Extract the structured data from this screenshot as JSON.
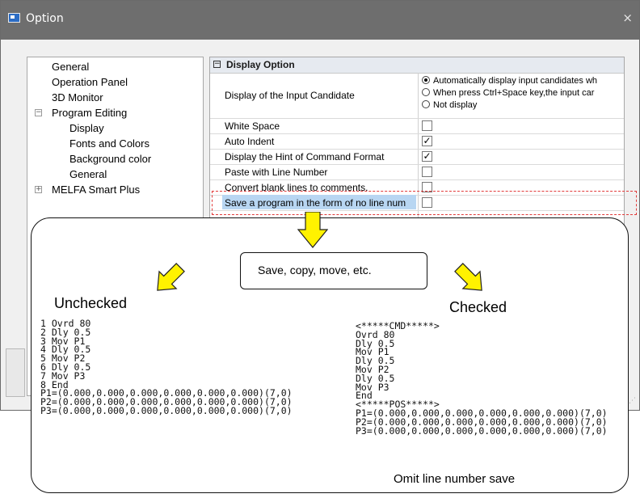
{
  "window": {
    "title": "Option",
    "close_glyph": "×"
  },
  "tree": [
    {
      "label": "General",
      "level": 0
    },
    {
      "label": "Operation Panel",
      "level": 0
    },
    {
      "label": "3D Monitor",
      "level": 0
    },
    {
      "label": "Program Editing",
      "level": 0,
      "expander": "−"
    },
    {
      "label": "Display",
      "level": 1
    },
    {
      "label": "Fonts and Colors",
      "level": 1
    },
    {
      "label": "Background color",
      "level": 1
    },
    {
      "label": "General",
      "level": 1
    },
    {
      "label": "MELFA Smart Plus",
      "level": 0,
      "expander": "+"
    }
  ],
  "grid": {
    "header_expander": "−",
    "header": "Display Option",
    "input_candidate": {
      "label": "Display of the Input Candidate",
      "options": [
        "Automatically display input candidates wh",
        "When press Ctrl+Space key,the input car",
        "Not display"
      ],
      "selected": 0
    },
    "rows": [
      {
        "label": "White Space",
        "checked": false
      },
      {
        "label": "Auto Indent",
        "checked": true
      },
      {
        "label": "Display the Hint of Command Format",
        "checked": true
      },
      {
        "label": "Paste with Line Number",
        "checked": false
      },
      {
        "label": "Convert blank lines to comments.",
        "checked": false
      },
      {
        "label": "Save a program in the form of no line num",
        "checked": false,
        "selected": true
      }
    ],
    "check_glyph": "✓"
  },
  "callout": {
    "action": "Save, copy, move, etc.",
    "unchecked_label": "Unchecked",
    "checked_label": "Checked",
    "footer": "Omit line number save",
    "unchecked_code": [
      "1 Ovrd 80",
      "2 Dly 0.5",
      "3 Mov P1",
      "4 Dly 0.5",
      "5 Mov P2",
      "6 Dly 0.5",
      "7 Mov P3",
      "8 End",
      "P1=(0.000,0.000,0.000,0.000,0.000,0.000)(7,0)",
      "P2=(0.000,0.000,0.000,0.000,0.000,0.000)(7,0)",
      "P3=(0.000,0.000,0.000,0.000,0.000,0.000)(7,0)"
    ],
    "checked_code": [
      "<*****CMD*****>",
      "Ovrd 80",
      "Dly 0.5",
      "Mov P1",
      "Dly 0.5",
      "Mov P2",
      "Dly 0.5",
      "Mov P3",
      "End",
      "<*****POS*****>",
      "P1=(0.000,0.000,0.000,0.000,0.000,0.000)(7,0)",
      "P2=(0.000,0.000,0.000,0.000,0.000,0.000)(7,0)",
      "P3=(0.000,0.000,0.000,0.000,0.000,0.000)(7,0)"
    ]
  },
  "colors": {
    "arrow_fill": "#fff200",
    "highlight": "#e23a3a",
    "selection": "#b8d6f2"
  }
}
